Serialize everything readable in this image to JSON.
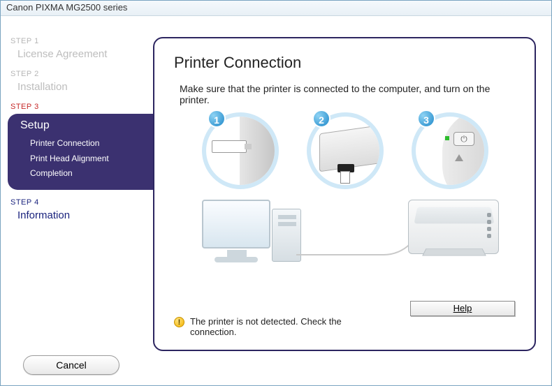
{
  "window": {
    "title": "Canon PIXMA MG2500 series"
  },
  "steps": {
    "s1": {
      "label": "STEP 1",
      "title": "License Agreement"
    },
    "s2": {
      "label": "STEP 2",
      "title": "Installation"
    },
    "s3": {
      "label": "STEP 3",
      "title": "Setup",
      "subs": [
        "Printer Connection",
        "Print Head Alignment",
        "Completion"
      ]
    },
    "s4": {
      "label": "STEP 4",
      "title": "Information"
    }
  },
  "main": {
    "heading": "Printer Connection",
    "instruction": "Make sure that the printer is connected to the computer, and turn on the printer.",
    "badges": {
      "b1": "1",
      "b2": "2",
      "b3": "3"
    },
    "power_glyph": "⏻",
    "warning": "The printer is not detected. Check the connection.",
    "help": "Help"
  },
  "buttons": {
    "cancel": "Cancel"
  }
}
